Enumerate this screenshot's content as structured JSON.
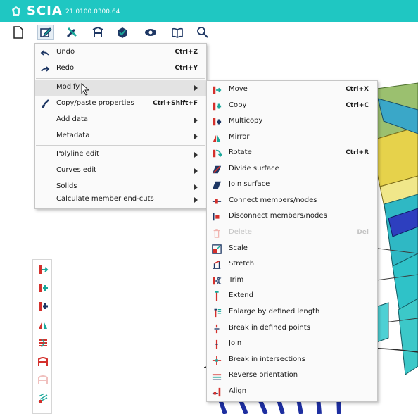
{
  "app": {
    "brand": "SCIA",
    "version": "21.0100.0300.64"
  },
  "main_menu": {
    "undo": {
      "label": "Undo",
      "shortcut": "Ctrl+Z"
    },
    "redo": {
      "label": "Redo",
      "shortcut": "Ctrl+Y"
    },
    "modify": {
      "label": "Modify"
    },
    "copy_paste": {
      "label": "Copy/paste properties",
      "shortcut": "Ctrl+Shift+F"
    },
    "add_data": {
      "label": "Add data"
    },
    "metadata": {
      "label": "Metadata"
    },
    "polyline_edit": {
      "label": "Polyline edit"
    },
    "curves_edit": {
      "label": "Curves edit"
    },
    "solids": {
      "label": "Solids"
    },
    "calc_end_cuts": {
      "label": "Calculate member end-cuts"
    }
  },
  "modify_menu": {
    "move": {
      "label": "Move",
      "shortcut": "Ctrl+X"
    },
    "copy": {
      "label": "Copy",
      "shortcut": "Ctrl+C"
    },
    "multicopy": {
      "label": "Multicopy"
    },
    "mirror": {
      "label": "Mirror"
    },
    "rotate": {
      "label": "Rotate",
      "shortcut": "Ctrl+R"
    },
    "divide_surface": {
      "label": "Divide surface"
    },
    "join_surface": {
      "label": "Join surface"
    },
    "connect": {
      "label": "Connect members/nodes"
    },
    "disconnect": {
      "label": "Disconnect members/nodes"
    },
    "delete": {
      "label": "Delete",
      "shortcut": "Del"
    },
    "scale": {
      "label": "Scale"
    },
    "stretch": {
      "label": "Stretch"
    },
    "trim": {
      "label": "Trim"
    },
    "extend": {
      "label": "Extend"
    },
    "enlarge": {
      "label": "Enlarge by defined length"
    },
    "break_points": {
      "label": "Break in defined points"
    },
    "join": {
      "label": "Join"
    },
    "break_intersections": {
      "label": "Break in intersections"
    },
    "reverse": {
      "label": "Reverse orientation"
    },
    "align": {
      "label": "Align"
    }
  },
  "colors": {
    "titlebar": "#1fc7c2",
    "icon_red": "#d4302c",
    "icon_teal": "#1aa89a",
    "icon_navy": "#1e3764"
  }
}
